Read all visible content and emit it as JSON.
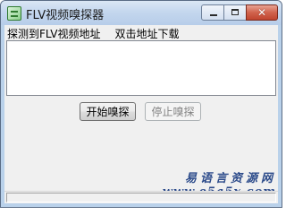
{
  "window": {
    "title": "FLV视频嗅探器",
    "controls": {
      "minimize_icon": "minimize-icon",
      "maximize_icon": "maximize-icon",
      "close_glyph": "✕"
    }
  },
  "main": {
    "hint_left": "探测到FLV视频地址",
    "hint_right": "双击地址下载",
    "url_list": [],
    "start_button": "开始嗅探",
    "stop_button": "停止嗅探",
    "stop_button_enabled": false
  },
  "watermark": {
    "line1": "易语言资源网",
    "line2": "www.e5a5x.com"
  },
  "statusbar": {
    "text": ""
  },
  "colors": {
    "title_bar": "#c4d7ee",
    "close_button": "#c0452f",
    "watermark": "#2b4a8a"
  }
}
